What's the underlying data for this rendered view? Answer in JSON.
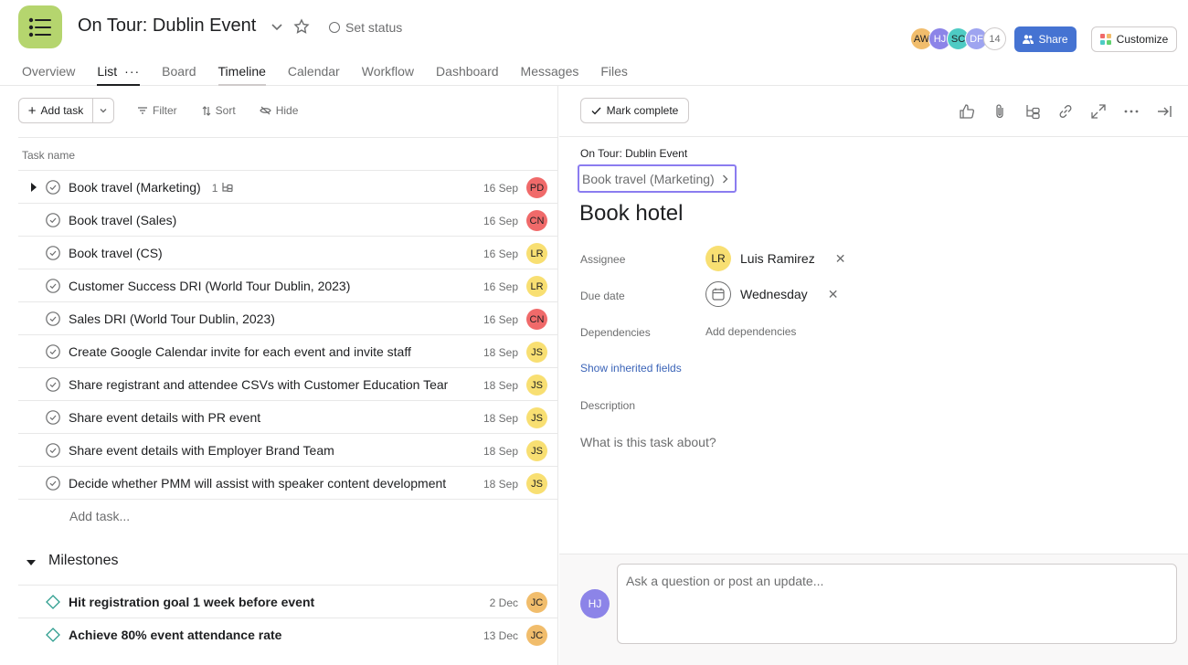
{
  "header": {
    "project_title": "On Tour: Dublin Event",
    "set_status": "Set status",
    "avatars": [
      {
        "initials": "AW",
        "color": "#f1bd6c"
      },
      {
        "initials": "HJ",
        "color": "#8c84e8"
      },
      {
        "initials": "SC",
        "color": "#4ecbc4"
      },
      {
        "initials": "DF",
        "color": "#9ea4f0"
      }
    ],
    "member_count": "14",
    "share_label": "Share",
    "customize_label": "Customize",
    "tabs": [
      "Overview",
      "List",
      "Board",
      "Timeline",
      "Calendar",
      "Workflow",
      "Dashboard",
      "Messages",
      "Files"
    ]
  },
  "toolbar": {
    "add_task": "Add task",
    "filter": "Filter",
    "sort": "Sort",
    "hide": "Hide"
  },
  "list": {
    "column_task_name": "Task name",
    "tasks": [
      {
        "name": "Book travel (Marketing)",
        "subtasks": "1",
        "date": "16 Sep",
        "assignee": "PD",
        "color": "#f06a6a",
        "expandable": true
      },
      {
        "name": "Book travel (Sales)",
        "subtasks": "",
        "date": "16 Sep",
        "assignee": "CN",
        "color": "#f06a6a"
      },
      {
        "name": "Book travel (CS)",
        "subtasks": "",
        "date": "16 Sep",
        "assignee": "LR",
        "color": "#f8df72"
      },
      {
        "name": "Customer Success DRI (World Tour Dublin, 2023)",
        "subtasks": "",
        "date": "16 Sep",
        "assignee": "LR",
        "color": "#f8df72"
      },
      {
        "name": "Sales DRI (World Tour Dublin, 2023)",
        "subtasks": "",
        "date": "16 Sep",
        "assignee": "CN",
        "color": "#f06a6a"
      },
      {
        "name": "Create Google Calendar invite for each event and invite staff",
        "subtasks": "",
        "date": "18 Sep",
        "assignee": "JS",
        "color": "#f8df72"
      },
      {
        "name": "Share registrant and attendee CSVs with Customer Education Team",
        "subtasks": "",
        "date": "18 Sep",
        "assignee": "JS",
        "color": "#f8df72"
      },
      {
        "name": "Share event details with PR event",
        "subtasks": "",
        "date": "18 Sep",
        "assignee": "JS",
        "color": "#f8df72"
      },
      {
        "name": "Share event details with Employer Brand Team",
        "subtasks": "",
        "date": "18 Sep",
        "assignee": "JS",
        "color": "#f8df72"
      },
      {
        "name": "Decide whether PMM will assist with speaker content development",
        "subtasks": "",
        "date": "18 Sep",
        "assignee": "JS",
        "color": "#f8df72"
      }
    ],
    "add_task_placeholder": "Add task...",
    "section_label": "Milestones",
    "milestones": [
      {
        "name": "Hit registration goal 1 week before event",
        "date": "2 Dec",
        "assignee": "JC",
        "color": "#f1bd6c"
      },
      {
        "name": "Achieve 80% event attendance rate",
        "date": "13 Dec",
        "assignee": "JC",
        "color": "#f1bd6c"
      }
    ]
  },
  "detail": {
    "mark_complete": "Mark complete",
    "breadcrumb_project": "On Tour: Dublin Event",
    "breadcrumb_parent": "Book travel (Marketing)",
    "title": "Book hotel",
    "assignee_label": "Assignee",
    "assignee_initials": "LR",
    "assignee_name": "Luis Ramirez",
    "due_label": "Due date",
    "due_value": "Wednesday",
    "dependencies_label": "Dependencies",
    "add_dependencies": "Add dependencies",
    "show_inherited": "Show inherited fields",
    "description_label": "Description",
    "description_placeholder": "What is this task about?",
    "comment_avatar": "HJ",
    "comment_placeholder": "Ask a question or post an update..."
  }
}
